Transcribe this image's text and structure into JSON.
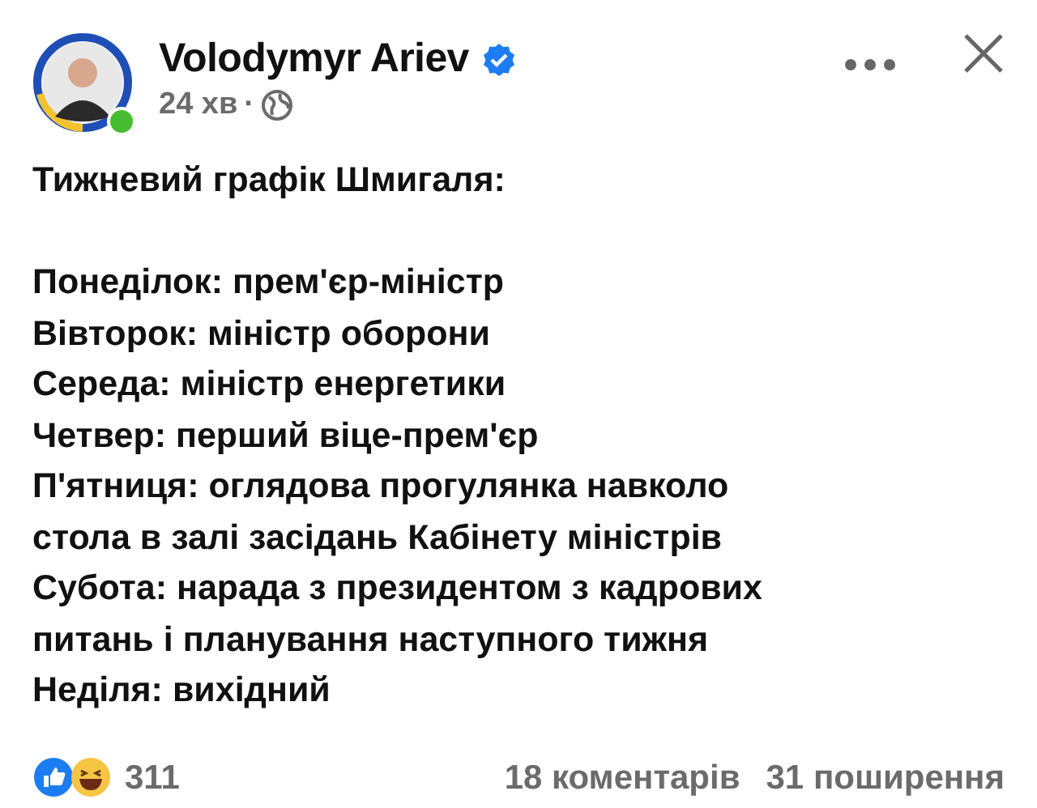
{
  "author": {
    "name": "Volodymyr Ariev",
    "verified": true,
    "online": true
  },
  "meta": {
    "time": "24 хв",
    "separator": "·"
  },
  "post": {
    "heading": "Тижневий графік Шмигаля:",
    "lines": [
      "Понеділок: прем'єр-міністр",
      "Вівторок: міністр оборони",
      "Середа: міністр енергетики",
      "Четвер: перший віце-прем'єр",
      "П'ятниця: оглядова прогулянка навколо\nстола в залі засідань Кабінету міністрів",
      "Субота: нарада з президентом з кадрових\nпитань і планування наступного тижня",
      "Неділя: вихідний"
    ]
  },
  "footer": {
    "reactions_count": "311",
    "comments": "18 коментарів",
    "shares": "31 поширення"
  }
}
